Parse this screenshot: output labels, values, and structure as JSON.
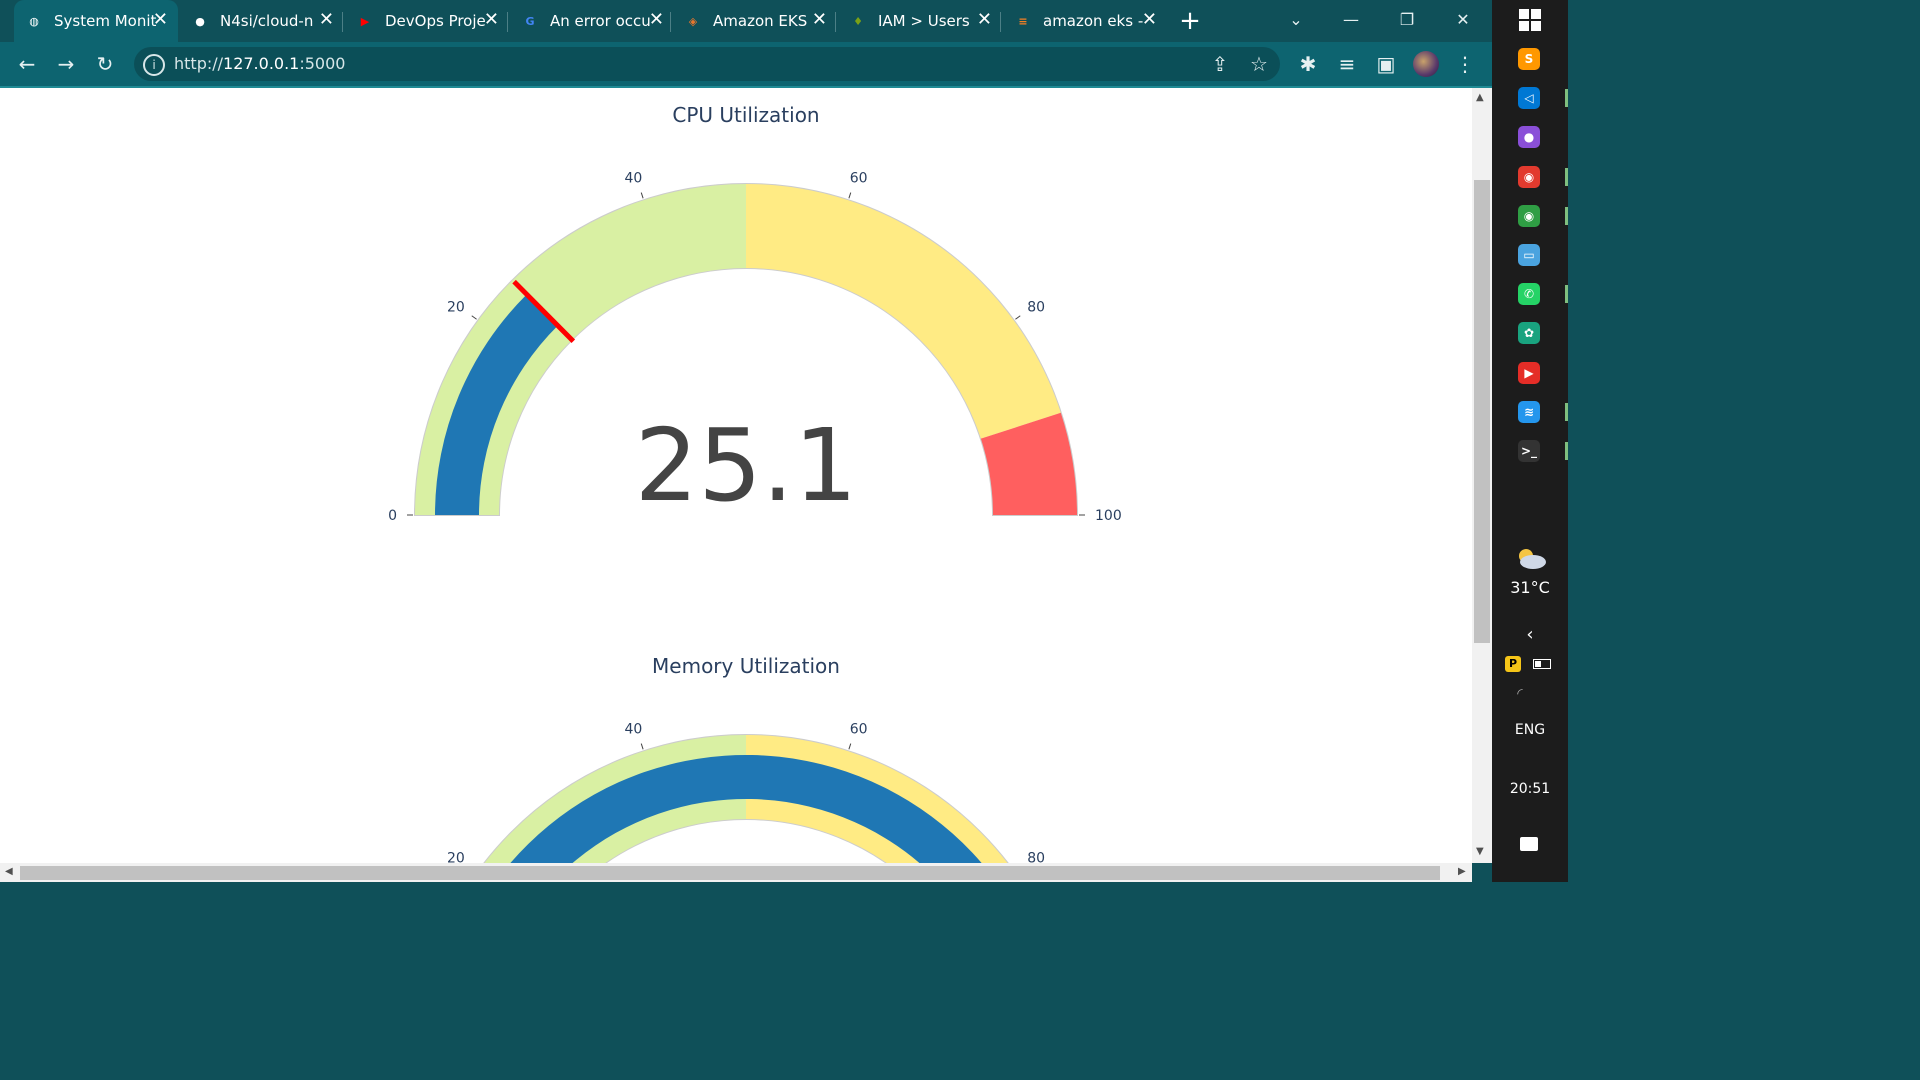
{
  "browser": {
    "tabs": [
      {
        "label": "System Monit",
        "favicon": "globe-icon",
        "active": true,
        "color": "#ffffff"
      },
      {
        "label": "N4si/cloud-n",
        "favicon": "github-icon",
        "active": false,
        "color": "#ffffff"
      },
      {
        "label": "DevOps Proje",
        "favicon": "youtube-icon",
        "active": false,
        "color": "#ff0000"
      },
      {
        "label": "An error occu",
        "favicon": "google-icon",
        "active": false,
        "color": "#4285f4"
      },
      {
        "label": "Amazon EKS",
        "favicon": "aws-eks-icon",
        "active": false,
        "color": "#e8762d"
      },
      {
        "label": "IAM > Users",
        "favicon": "aws-iam-icon",
        "active": false,
        "color": "#7aa116"
      },
      {
        "label": "amazon eks -",
        "favicon": "stackoverflow-icon",
        "active": false,
        "color": "#f48024"
      }
    ],
    "new_tab": "+",
    "address": {
      "prefix": "http://",
      "host": "127.0.0.1",
      "suffix": ":5000"
    }
  },
  "page": {
    "gauges": [
      {
        "title": "CPU Utilization",
        "value_text": "25.1",
        "chart_data": {
          "type": "gauge",
          "value": 25.1,
          "range": [
            0,
            100
          ],
          "ticks": [
            "0",
            "20",
            "40",
            "60",
            "80",
            "100"
          ],
          "steps": [
            {
              "range": [
                0,
                50
              ],
              "color": "#d9f0a3"
            },
            {
              "range": [
                50,
                90
              ],
              "color": "#ffeb84"
            },
            {
              "range": [
                90,
                100
              ],
              "color": "#ff5f5f"
            }
          ],
          "bar_color": "#1f77b4",
          "threshold": {
            "value": 25.1,
            "color": "#ff0000"
          }
        }
      },
      {
        "title": "Memory Utilization",
        "chart_data": {
          "type": "gauge",
          "value": 90,
          "range": [
            0,
            100
          ],
          "ticks": [
            "20",
            "40",
            "60",
            "80"
          ],
          "steps": [
            {
              "range": [
                0,
                50
              ],
              "color": "#d9f0a3"
            },
            {
              "range": [
                50,
                90
              ],
              "color": "#ffeb84"
            }
          ],
          "bar_color": "#1f77b4"
        }
      }
    ]
  },
  "taskbar": {
    "apps": [
      "sublime-text-icon",
      "vscode-icon",
      "github-desktop-icon",
      "chrome-icon",
      "chrome-profile-icon",
      "laptop-icon",
      "whatsapp-icon",
      "chatgpt-icon",
      "youtube-music-icon",
      "docker-icon",
      "terminal-icon"
    ],
    "weather": "31°C",
    "language": "ENG",
    "time": "20:51"
  }
}
